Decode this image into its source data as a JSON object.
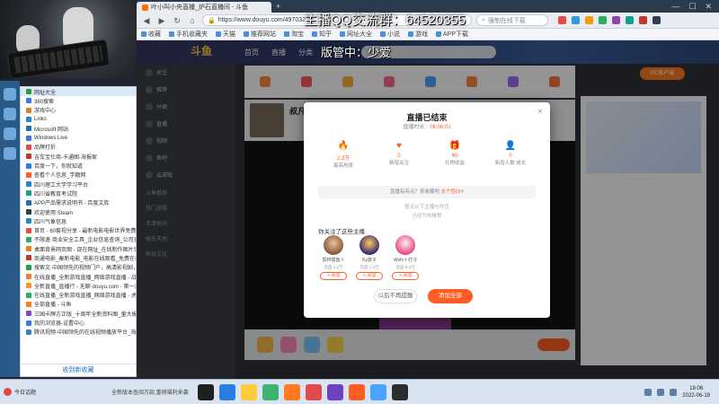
{
  "browser": {
    "tab_title": "叶小叫小央直播_炉石直播间 - 斗鱼",
    "url": "https://www.douyu.com/497032",
    "search_placeholder": "强制在线下载",
    "bookmarks": [
      "收藏",
      "手机收藏夹",
      "天猫",
      "推荐网站",
      "淘宝",
      "知乎",
      "网址大全",
      "小说",
      "游戏",
      "APP下载"
    ]
  },
  "favorites": {
    "items": [
      "网址大全",
      "360搜索",
      "游戏中心",
      "Links",
      "Microsoft 网站",
      "Windows Live",
      "品牌打折",
      "吉车宝仕商-卡通图-海报家",
      "百度一下，你就知道",
      "查看个人信息_学籍网",
      "四川理工大学学习平台",
      "四川省教育考试院",
      "APP产品需求说明书 - 百度文库",
      "欢迎使用 Steam",
      "四川气象信息",
      "首页 - 60套视分享 - 最新电影电影世界免费下载",
      "不限速·商业安全工具_企业信息查询_公司查询_工商",
      "桌面背景网页图 - 现在网址_在线制作图片完图片在线",
      "商通电影_秦新电影_电影在线观看_免费在线下载_",
      "搜索文·中国领先的视频门户，高清影视剧，网络视",
      "在线直播_全新游戏直播_网络游戏直播 - 战旗直播",
      "全新直播_直播行 - 无聊·douyu.com - 第一游戏",
      "在线直播_全新游戏直播_网络游戏直播 - 虎牙直播",
      "全部直播 - 斗鱼",
      "三国卡牌方正版_十周年全新资料图_量大爆率鹅",
      "我的浏览器-设置中心",
      "腾讯视频-中国领先的在线视频播放平台_海量高清"
    ],
    "footer": "收到新收藏"
  },
  "page": {
    "logo": "斗鱼",
    "nav": [
      "首页",
      "直播",
      "分类"
    ],
    "pc_button": "PC客户端",
    "stream_name": "叔凡",
    "side_nav_items": [
      "关注",
      "推荐",
      "分类",
      "直播",
      "视频",
      "鱼吧",
      "云游戏"
    ],
    "side_sections": [
      "斗鱼推荐",
      "热门游戏",
      "手游休闲",
      "娱乐天地",
      "科技文化"
    ]
  },
  "modal": {
    "title": "直播已结束",
    "duration_label": "直播时长：",
    "duration_value": "06:06:01",
    "close_icon": "×",
    "stats": [
      {
        "icon": "fire-icon",
        "value": "2.3万",
        "label": "最高热度"
      },
      {
        "icon": "heart-icon",
        "value": "0",
        "label": "新增关注"
      },
      {
        "icon": "gift-icon",
        "value": "¥0",
        "label": "礼物收益"
      },
      {
        "icon": "user-icon",
        "value": "0",
        "label": "新增人数 成长"
      }
    ],
    "share_text": "直播有亮点？来收藏吧",
    "share_link": "去个性DIY",
    "hint1": "暂无以下主播与你互",
    "hint2": "已经为你推荐",
    "follow_title": "你关注了这些主播",
    "follows": [
      {
        "name": "郭林摸鱼人",
        "hot": "热度 1.1万",
        "add": "+ 添加"
      },
      {
        "name": "Ky旅子",
        "hot": "热度 1.3万",
        "add": "+ 添加"
      },
      {
        "name": "Wxfx卜灯冷",
        "hot": "热度 8.4万",
        "add": "+ 添加"
      }
    ],
    "later_btn": "以后不再提醒",
    "followall_btn": "添加全部"
  },
  "overlay": {
    "line1": "主播QQ交流群：64520355",
    "line2": "版管中：少爱"
  },
  "taskbar": {
    "news_label": "今日话题",
    "ticker": "全新版本查阅万款,重磅福利来袭",
    "time": "19:06",
    "date": "2022-06-19"
  }
}
